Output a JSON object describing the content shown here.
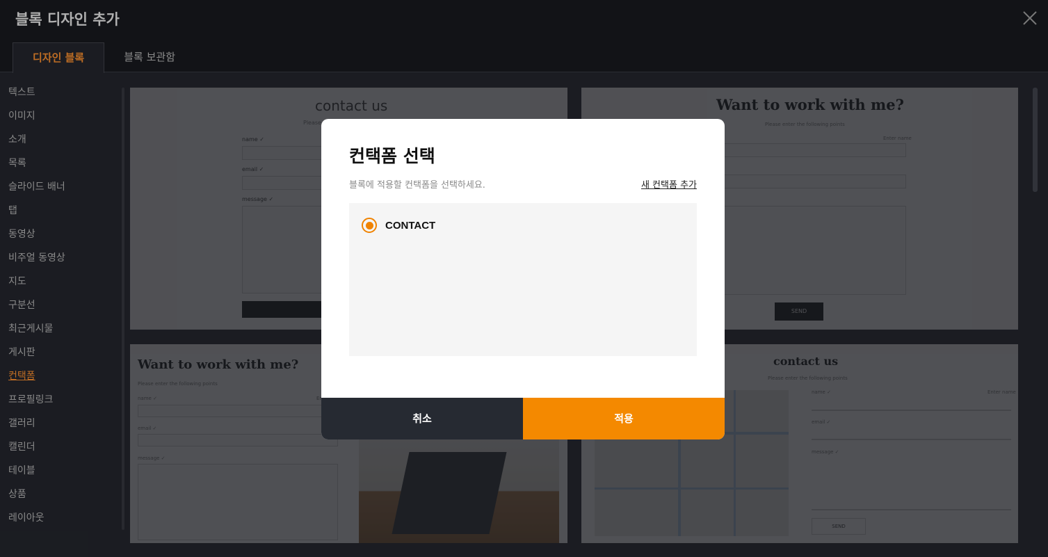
{
  "header": {
    "title": "블록 디자인 추가"
  },
  "tabs": [
    {
      "label": "디자인 블록",
      "active": true
    },
    {
      "label": "블록 보관함",
      "active": false
    }
  ],
  "sidebar": {
    "items": [
      {
        "label": "텍스트"
      },
      {
        "label": "이미지"
      },
      {
        "label": "소개"
      },
      {
        "label": "목록"
      },
      {
        "label": "슬라이드 배너"
      },
      {
        "label": "탭"
      },
      {
        "label": "동영상"
      },
      {
        "label": "비주얼 동영상"
      },
      {
        "label": "지도"
      },
      {
        "label": "구분선"
      },
      {
        "label": "최근게시물"
      },
      {
        "label": "게시판"
      },
      {
        "label": "컨택폼",
        "active": true
      },
      {
        "label": "프로필링크"
      },
      {
        "label": "갤러리"
      },
      {
        "label": "캘린더"
      },
      {
        "label": "테이블"
      },
      {
        "label": "상품"
      },
      {
        "label": "레이아웃"
      }
    ]
  },
  "previews": {
    "card1": {
      "title": "contact us",
      "subtitle": "Please",
      "name": "name ✓",
      "email": "email ✓",
      "message": "message ✓"
    },
    "card2": {
      "title": "Want to work with me?",
      "subtitle": "Please enter the following points",
      "hint": "Enter name",
      "send": "SEND"
    },
    "card3": {
      "title": "Want to work with me?",
      "subtitle": "Please enter the following points",
      "name": "name ✓",
      "email": "email ✓",
      "message": "message ✓",
      "hint": "Ent"
    },
    "card4": {
      "title": "contact us",
      "subtitle": "Please enter the following points",
      "name": "name ✓",
      "hint": "Enter name",
      "email": "email ✓",
      "message": "message ✓",
      "send": "SEND"
    }
  },
  "modal": {
    "title": "컨택폼 선택",
    "description": "블록에 적용할 컨택폼을 선택하세요.",
    "add_link": "새 컨택폼 추가",
    "options": [
      {
        "label": "CONTACT",
        "selected": true
      }
    ],
    "cancel_label": "취소",
    "apply_label": "적용",
    "accent_color": "#f48900"
  }
}
